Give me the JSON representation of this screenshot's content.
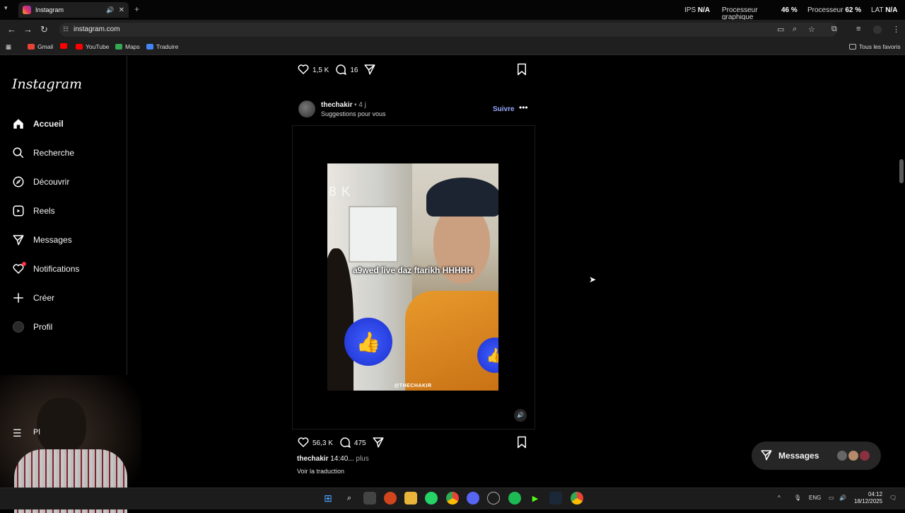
{
  "browser": {
    "tab_title": "Instagram",
    "url": "instagram.com",
    "bookmarks": [
      "Gmail",
      "YouTube",
      "Maps",
      "Traduire"
    ],
    "all_bookmarks": "Tous les favoris"
  },
  "overlay_stats": {
    "ips_label": "IPS",
    "ips_value": "N/A",
    "gpu_label": "Processeur graphique",
    "gpu_value": "46 %",
    "cpu_label": "Processeur",
    "cpu_value": "62 %",
    "lat_label": "LAT",
    "lat_value": "N/A"
  },
  "instagram": {
    "logo": "Instagram",
    "nav": [
      {
        "label": "Accueil",
        "icon": "home-icon"
      },
      {
        "label": "Recherche",
        "icon": "search-icon"
      },
      {
        "label": "Découvrir",
        "icon": "compass-icon"
      },
      {
        "label": "Reels",
        "icon": "reels-icon"
      },
      {
        "label": "Messages",
        "icon": "send-icon"
      },
      {
        "label": "Notifications",
        "icon": "heart-icon"
      },
      {
        "label": "Créer",
        "icon": "plus-icon"
      },
      {
        "label": "Profil",
        "icon": "avatar-icon"
      }
    ],
    "more_label": "Pl",
    "prev_post": {
      "likes": "1,5 K",
      "comments": "16"
    },
    "post": {
      "username": "thechakir",
      "time": "• 4 j",
      "subtitle": "Suggestions pour vous",
      "follow": "Suivre",
      "video_counter": "8 K",
      "video_caption": "a9wed live daz ftarikh HHHHH",
      "watermark": "@THECHAKIR",
      "likes": "56,3 K",
      "comments": "475",
      "caption_user": "thechakir",
      "caption_text": "14:40...",
      "caption_more": "plus",
      "translate": "Voir la traduction"
    },
    "messages_button": "Messages"
  },
  "taskbar": {
    "lang": "ENG",
    "time": "04:12",
    "date": "18/12/2025"
  },
  "colors": {
    "accent_follow": "#9aa8ff",
    "notif_dot": "#ff3040",
    "like_button": "#2a44e8"
  }
}
